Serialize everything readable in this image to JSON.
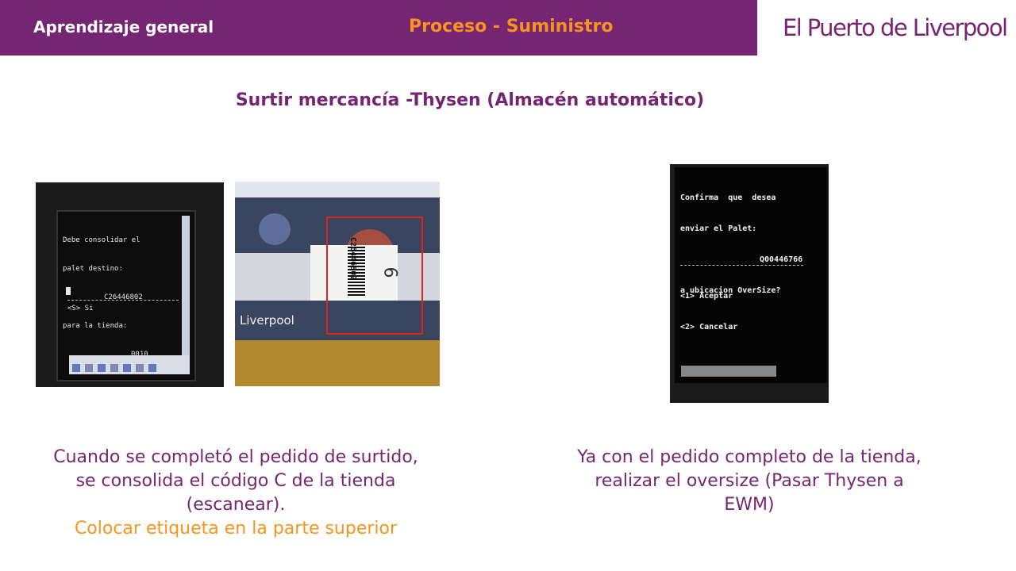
{
  "header": {
    "section": "Aprendizaje general",
    "process": "Proceso - Suministro",
    "logo": "El Puerto de Liverpool"
  },
  "title": "Surtir mercancía -Thysen (Almacén automático)",
  "photos": {
    "left_screen": {
      "line1": "Debe consolidar el",
      "line2": "palet destino:",
      "line3": "C26446802",
      "line4": "para la tienda:",
      "line5": "0010",
      "option": "<S> Si"
    },
    "package": {
      "brand": "Liverpool",
      "code": "C26446802",
      "handwritten": "6"
    },
    "right_screen": {
      "line1": "Confirma  que  desea",
      "line2": "enviar el Palet:",
      "line3": "Q00446766",
      "line4": "a ubicacion OverSize?",
      "option1": "<1> Aceptar",
      "option2": "<2> Cancelar"
    }
  },
  "captions": {
    "left_main": "Cuando se completó el pedido de surtido, se consolida el código C de la tienda (escanear).",
    "left_accent": "Colocar etiqueta en la parte superior",
    "right_main": "Ya con el pedido completo de la tienda, realizar el oversize (Pasar Thysen a EWM)"
  },
  "colors": {
    "brand_purple": "#762572",
    "accent_orange": "#f7941d"
  }
}
